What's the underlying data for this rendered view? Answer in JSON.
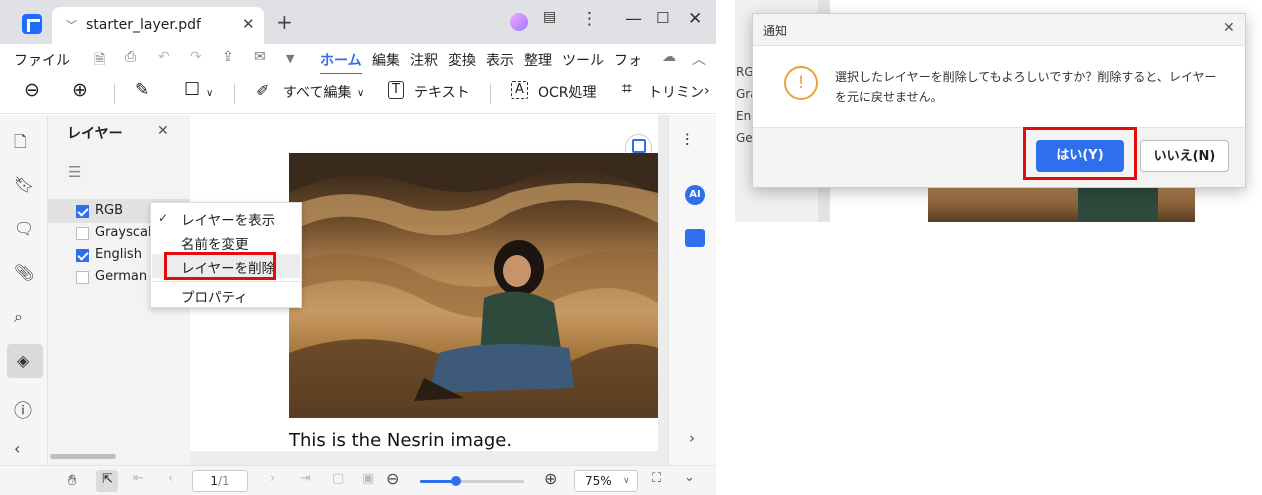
{
  "app": {
    "tab_title": "starter_layer.pdf",
    "menu": {
      "file": "ファイル",
      "items": [
        "ホーム",
        "編集",
        "注釈",
        "変換",
        "表示",
        "整理",
        "ツール",
        "フォ"
      ]
    },
    "toolbar": {
      "edit_all": "すべて編集",
      "text": "テキスト",
      "ocr": "OCR処理",
      "trim": "トリミン"
    },
    "layer_panel": {
      "title": "レイヤー",
      "layers": [
        {
          "name": "RGB",
          "checked": true
        },
        {
          "name": "Grayscale",
          "checked": false
        },
        {
          "name": "English",
          "checked": true
        },
        {
          "name": "German",
          "checked": false
        }
      ]
    },
    "context_menu": {
      "show_layer": "レイヤーを表示",
      "rename": "名前を変更",
      "delete_layer": "レイヤーを削除",
      "properties": "プロパティ"
    },
    "document": {
      "caption": "This is the Nesrin image."
    },
    "status": {
      "page_current": "1",
      "page_total": "/1",
      "zoom": "75%"
    },
    "right_rail": {
      "ai_label": "AI"
    }
  },
  "dialog": {
    "title": "通知",
    "message_line1": "選択したレイヤーを削除してもよろしいですか？削除すると、レイヤー",
    "message_line2": "を元に戻せません。",
    "yes_label": "はい(Y)",
    "no_label": "いいえ(N)",
    "background_list": [
      "RGB",
      "Gra",
      "Eng",
      "Ge"
    ]
  },
  "colors": {
    "accent": "#2f6fed",
    "highlight_red": "#e30b0b",
    "warning": "#e8a23a"
  }
}
